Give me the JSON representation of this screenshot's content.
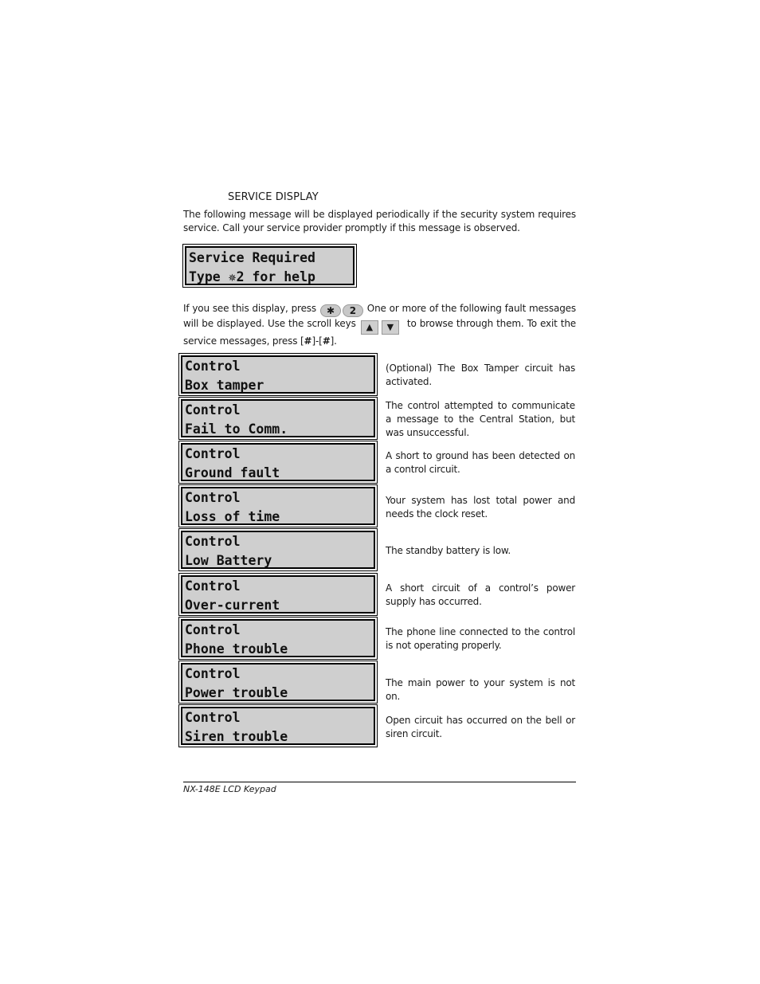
{
  "section": {
    "title": "SERVICE DISPLAY",
    "intro": "The following message will be displayed periodically if the security system requires service.  Call your service provider promptly if this message is observed."
  },
  "main_display": {
    "line1": "Service Required",
    "line2": "Type ✵2 for help"
  },
  "instructions": {
    "part1": "If you see this display, press",
    "key_star": "✱",
    "key_two": "2",
    "part2": "One or more of the following fault messages will be displayed.  Use the scroll keys",
    "key_up": "▲",
    "key_down": "▼",
    "part3": "to browse through them. To exit the service messages, press [",
    "hash1": "#",
    "part4": "]-[",
    "hash2": "#",
    "part5": "]."
  },
  "faults": [
    {
      "line1": "Control",
      "line2": "Box tamper",
      "description": "(Optional)  The Box Tamper circuit has activated."
    },
    {
      "line1": "Control",
      "line2": "Fail to Comm.",
      "description": "The control attempted to communicate a message to the Central Station, but was unsuccessful."
    },
    {
      "line1": "Control",
      "line2": "Ground fault",
      "description": "A short to ground has been detected on a control circuit."
    },
    {
      "line1": "Control",
      "line2": "Loss of time",
      "description": "Your system has lost total power and needs the clock reset."
    },
    {
      "line1": "Control",
      "line2": "Low Battery",
      "description": "The standby battery is low."
    },
    {
      "line1": "Control",
      "line2": "Over-current",
      "description": "A short circuit of a control’s power supply has occurred."
    },
    {
      "line1": "Control",
      "line2": "Phone trouble",
      "description": "The phone line connected to the control is not operating properly."
    },
    {
      "line1": "Control",
      "line2": "Power trouble",
      "description": "The main power to your system is not on."
    },
    {
      "line1": "Control",
      "line2": "Siren trouble",
      "description": "Open circuit has occurred on the bell or siren circuit."
    }
  ],
  "footer": {
    "text": "NX-148E LCD Keypad"
  }
}
